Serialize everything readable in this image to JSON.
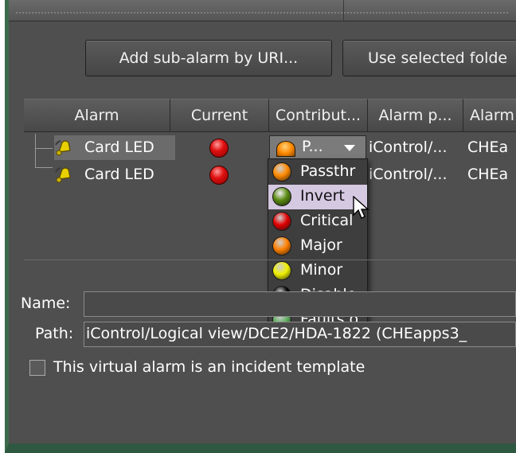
{
  "toolbar": {
    "add_button": "Add sub-alarm by URI...",
    "use_button": "Use selected folde"
  },
  "table": {
    "columns": [
      "Alarm",
      "Current",
      "Contribut...",
      "Alarm p...",
      "Alarm"
    ],
    "rows": [
      {
        "alarm": "Card LED",
        "contribution": "P...",
        "path": "iControl/...",
        "name": "CHEa"
      },
      {
        "alarm": "Card LED",
        "path": "iControl/...",
        "name": "CHEa"
      }
    ]
  },
  "dropdown": {
    "options": [
      {
        "label": "Passthr",
        "color": "#ff8a00"
      },
      {
        "label": "Invert",
        "color": "#5a8a10"
      },
      {
        "label": "Critical",
        "color": "#e00000"
      },
      {
        "label": "Major",
        "color": "#ff7f00"
      },
      {
        "label": "Minor",
        "color": "#f0f000"
      },
      {
        "label": "Disable",
        "color": "#000000"
      },
      {
        "label": "Faults o",
        "color": "#60b060"
      }
    ],
    "selected_index": 1
  },
  "form": {
    "name_label": "Name:",
    "name_value": "",
    "path_label": "Path:",
    "path_value": "iControl/Logical view/DCE2/HDA-1822 (CHEapps3_",
    "checkbox_label": "This virtual alarm is an incident template"
  }
}
